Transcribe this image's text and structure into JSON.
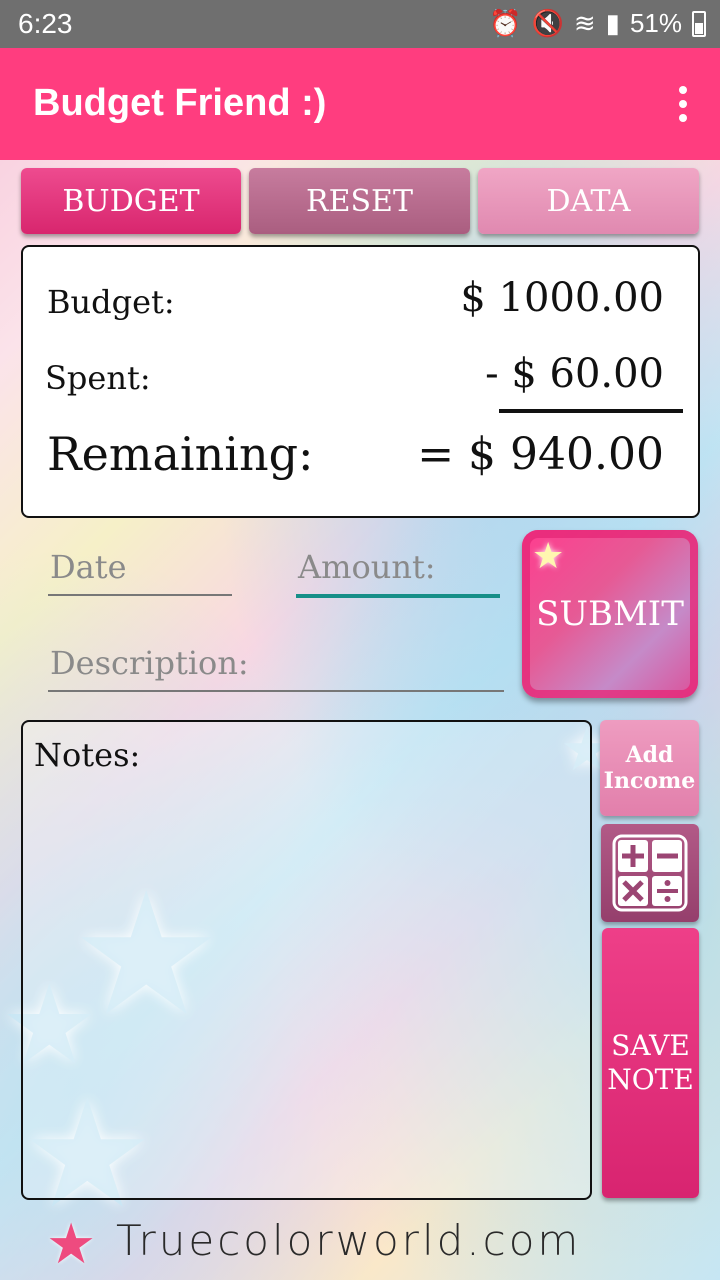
{
  "status_bar": {
    "time": "6:23",
    "battery": "51%",
    "icons": [
      "alarm-icon",
      "mute-icon",
      "wifi-icon",
      "signal-icon",
      "battery-icon"
    ]
  },
  "app_bar": {
    "title": "Budget Friend :)",
    "menu_icon": "more-vert-icon"
  },
  "tabs": {
    "budget": "BUDGET",
    "reset": "RESET",
    "data": "DATA"
  },
  "summary": {
    "budget_label": "Budget:",
    "budget_value": "$ 1000.00",
    "spent_label": "Spent:",
    "spent_value": "- $ 60.00",
    "remaining_label": "Remaining:",
    "remaining_value": "= $ 940.00"
  },
  "form": {
    "date_placeholder": "Date",
    "amount_placeholder": "Amount:",
    "description_placeholder": "Description:",
    "submit_label": "SUBMIT"
  },
  "notes": {
    "label": "Notes:"
  },
  "side_buttons": {
    "add_income_label": "Add Income",
    "calculator_icon": "calculator-icon",
    "save_note_label": "SAVE NOTE"
  },
  "footer": {
    "logo_text": "Truecolorworld.com"
  },
  "colors": {
    "app_bar": "#ff3d7f",
    "status_bar": "#6f6f6f",
    "accent_teal": "#168f88"
  }
}
